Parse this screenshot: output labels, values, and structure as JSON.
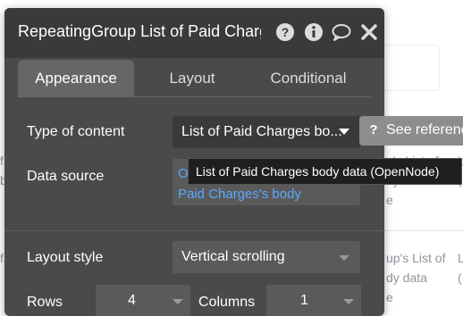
{
  "panel": {
    "title": "RepeatingGroup List of Paid Charg",
    "header_icons": [
      "help-icon",
      "info-icon",
      "comment-icon",
      "close-icon"
    ]
  },
  "tabs": [
    {
      "label": "Appearance",
      "active": true
    },
    {
      "label": "Layout",
      "active": false
    },
    {
      "label": "Conditional",
      "active": false
    }
  ],
  "fields": {
    "type_of_content": {
      "label": "Type of content",
      "value": "List of Paid Charges bo..."
    },
    "data_source": {
      "label": "Data source",
      "line1": "O",
      "line2": "Paid Charges's body"
    },
    "layout_style": {
      "label": "Layout style",
      "value": "Vertical scrolling"
    },
    "rows": {
      "label": "Rows",
      "value": "4"
    },
    "columns": {
      "label": "Columns",
      "value": "1"
    }
  },
  "tooltip": {
    "text": "List of Paid Charges body data (OpenNode)"
  },
  "reference_button": {
    "label": "See referenc"
  },
  "background": {
    "right_fragments": [
      "e's List of",
      "dy data",
      "e",
      "up's List of",
      "dy data",
      "e"
    ],
    "left_fragments": [
      "f",
      "b",
      "f"
    ],
    "far_right": [
      "L",
      "(",
      "L",
      "("
    ]
  }
}
